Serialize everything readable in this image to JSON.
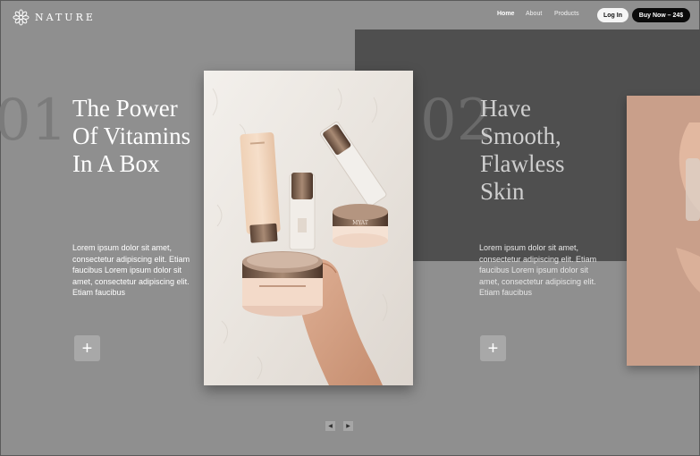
{
  "header": {
    "brand": "NATURE",
    "nav": [
      "Home",
      "About",
      "Products"
    ],
    "login_label": "Log In",
    "buy_label": "Buy Now – 24$"
  },
  "slides": [
    {
      "number": "01",
      "title_lines": [
        "The Power",
        "Of Vitamins",
        "In A Box"
      ],
      "text": "Lorem ipsum dolor sit amet, consectetur adipiscing elit. Etiam faucibus Lorem ipsum dolor sit amet, consectetur adipiscing elit. Etiam faucibus",
      "plus": "+"
    },
    {
      "number": "02",
      "title_lines": [
        "Have",
        "Smooth,",
        "Flawless",
        "Skin"
      ],
      "text": "Lorem ipsum dolor sit amet, consectetur adipiscing elit. Etiam faucibus Lorem ipsum dolor sit amet, consectetur adipiscing elit. Etiam faucibus",
      "plus": "+"
    }
  ],
  "product_labels": {
    "jar_large": "",
    "jar_small": "MYAT"
  },
  "controls": {
    "prev": "◀",
    "next": "▶"
  },
  "colors": {
    "background": "#8f8f8f",
    "dark_panel": "#4f4f4f",
    "buy_button": "#0b0b0b",
    "login_button": "#f5f5f5",
    "side_photo": "#c99f8a"
  },
  "icons": {
    "logo": "lotus-mandala-icon",
    "plus": "plus-icon",
    "prev": "arrow-left-icon",
    "next": "arrow-right-icon"
  }
}
